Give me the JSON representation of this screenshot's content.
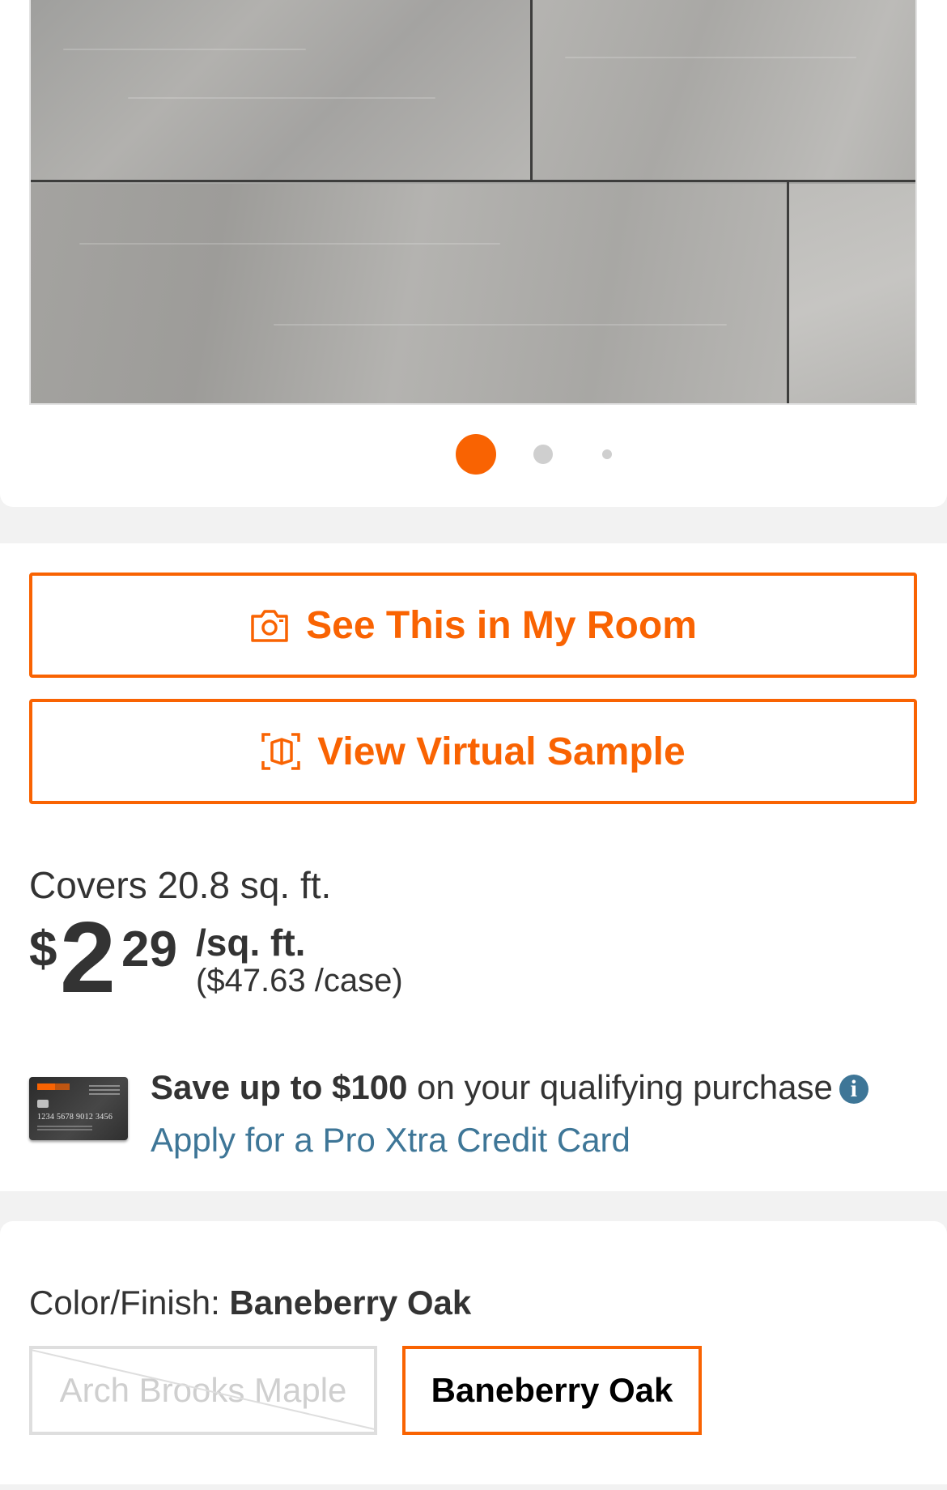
{
  "gallery": {
    "image_alt": "Gray wood-look plank flooring",
    "active_slide": 1,
    "slide_count": 3
  },
  "actions": {
    "room_label": "See This in My Room",
    "room_icon": "camera-icon",
    "virtual_label": "View Virtual Sample",
    "virtual_icon": "virtual-sample-icon"
  },
  "pricing": {
    "covers": "Covers 20.8 sq. ft.",
    "currency": "$",
    "whole": "2",
    "cents": "29",
    "unit": "/sq. ft.",
    "case_price": "($47.63 /case)"
  },
  "promo": {
    "save_bold": "Save up to $100",
    "save_rest": " on your qualifying purchase",
    "info_icon": "info-icon",
    "apply_link": "Apply for a Pro Xtra Credit Card",
    "card_number": "1234 5678 9012 3456"
  },
  "color": {
    "label": "Color/Finish: ",
    "selected": "Baneberry Oak",
    "options": [
      {
        "label": "Arch Brooks Maple",
        "available": false
      },
      {
        "label": "Baneberry Oak",
        "available": true,
        "selected": true
      }
    ]
  },
  "colors": {
    "accent": "#f96302",
    "link": "#3e7697",
    "text": "#333333",
    "background": "#f2f2f2"
  }
}
